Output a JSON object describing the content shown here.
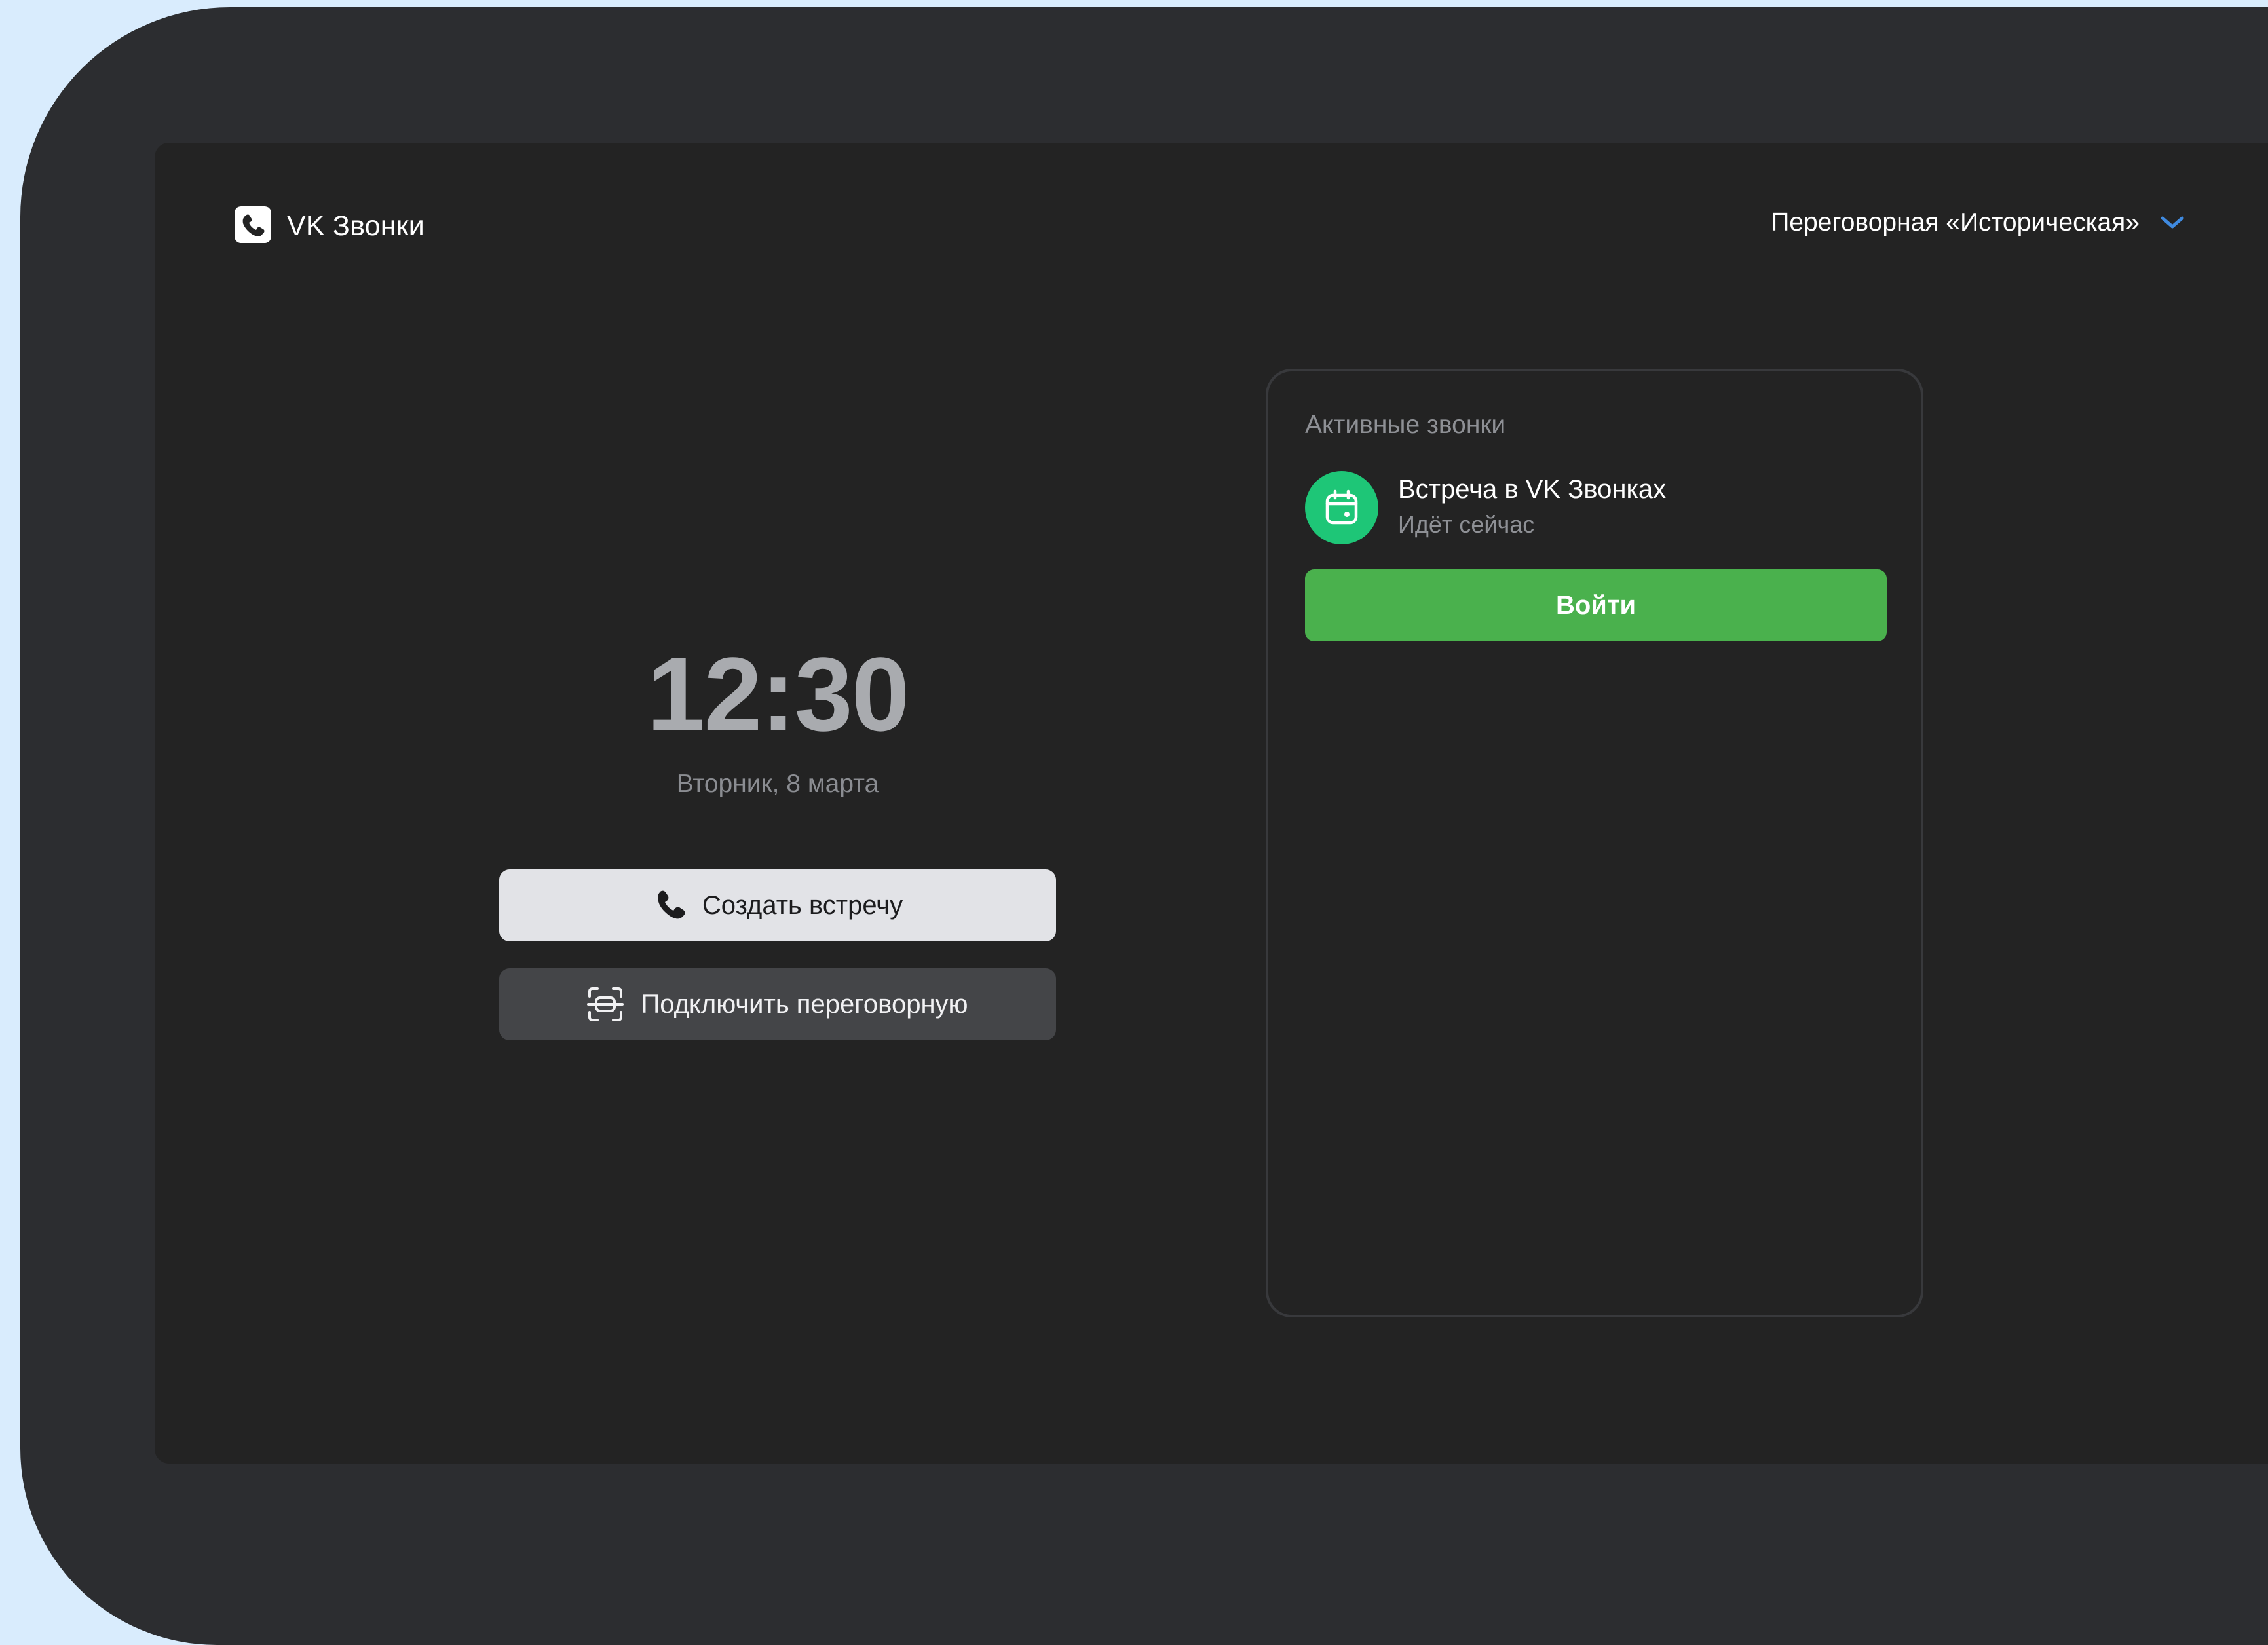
{
  "app": {
    "logo_text": "VK Звонки",
    "logo_icon": "phone-bubble-icon"
  },
  "room": {
    "selected": "Переговорная «Историческая»",
    "dropdown_icon": "chevron-down-icon",
    "accent_color": "#3f8ae0"
  },
  "clock": {
    "time": "12:30",
    "date": "Вторник, 8 марта"
  },
  "actions": {
    "create_label": "Создать встречу",
    "create_icon": "phone-icon",
    "connect_label": "Подключить переговорную",
    "connect_icon": "scan-room-icon"
  },
  "active_calls": {
    "title": "Активные звонки",
    "items": [
      {
        "title": "Встреча в VK Звонках",
        "status": "Идёт сейчас",
        "icon": "calendar-icon",
        "icon_color": "#1ec677",
        "join_label": "Войти",
        "join_color": "#4ab14d"
      }
    ]
  }
}
